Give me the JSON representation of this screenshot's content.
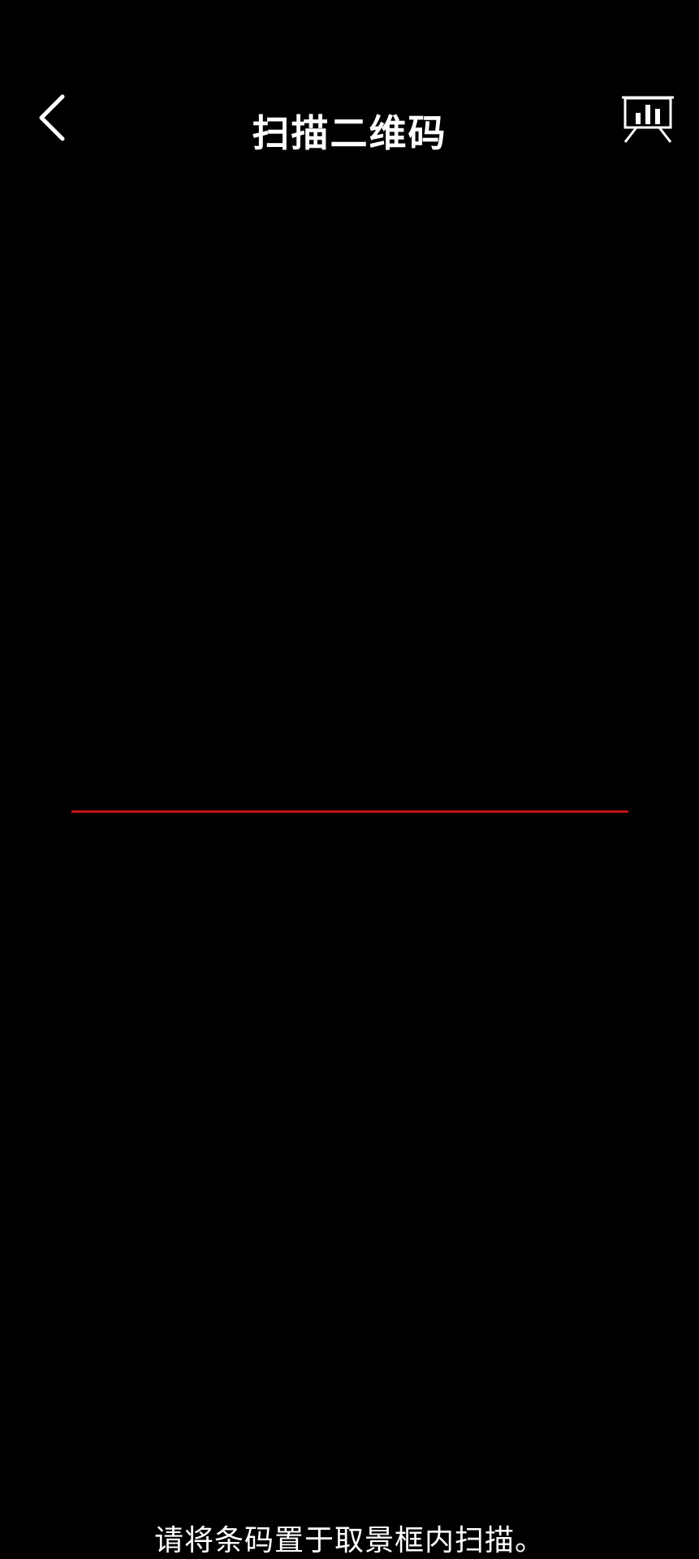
{
  "header": {
    "back_icon": "chevron-left-icon",
    "title": "扫描二维码",
    "album_icon": "presentation-chart-icon"
  },
  "scanner": {
    "scan_line_color": "#c0141a"
  },
  "hint": {
    "text": "请将条码置于取景框内扫描。"
  },
  "colors": {
    "background": "#000000",
    "foreground": "#ffffff"
  }
}
